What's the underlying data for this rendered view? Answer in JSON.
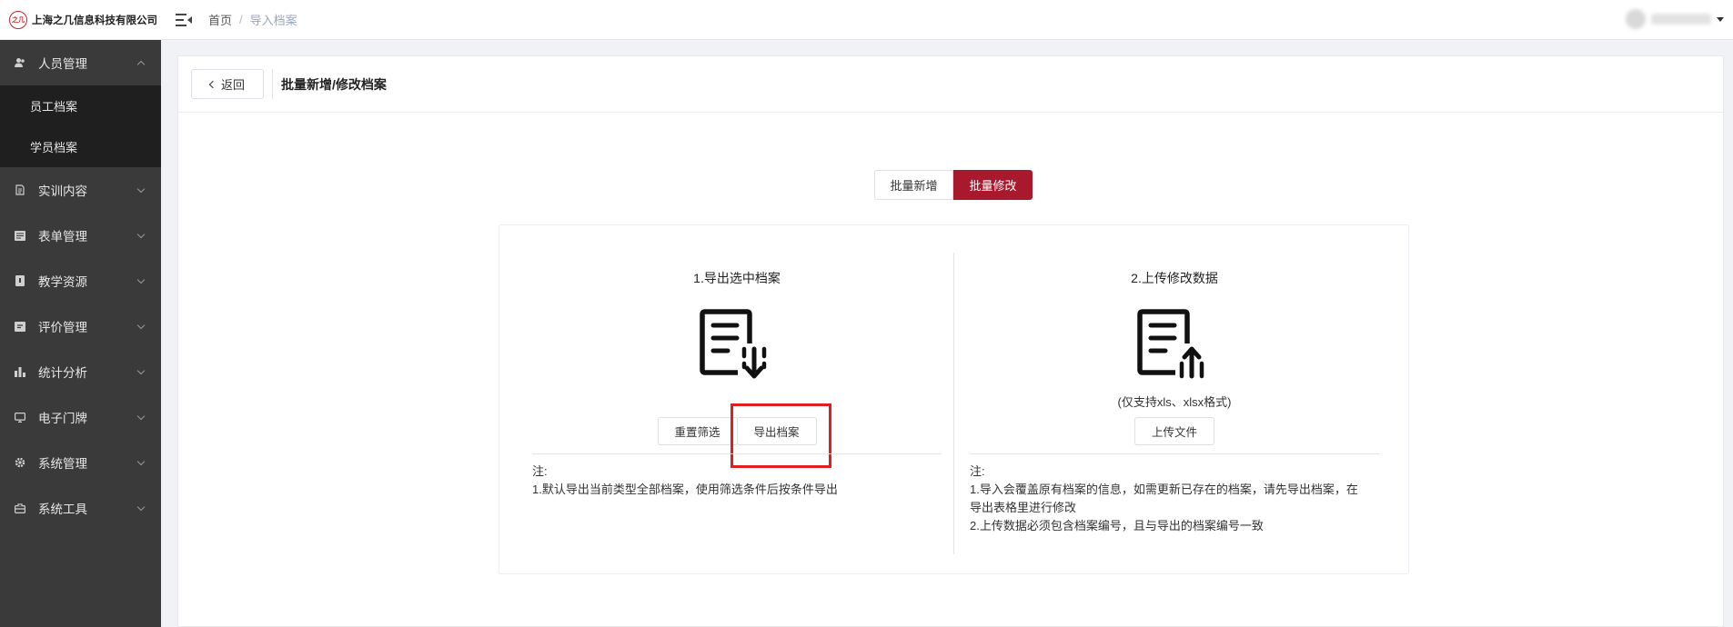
{
  "app": {
    "company_name": "上海之几信息科技有限公司",
    "logo_text": "之几"
  },
  "breadcrumb": {
    "home": "首页",
    "separator": "/",
    "current": "导入档案"
  },
  "sidebar": {
    "items": [
      {
        "label": "人员管理",
        "icon": "people-icon",
        "expanded": true,
        "children": [
          "员工档案",
          "学员档案"
        ]
      },
      {
        "label": "实训内容",
        "icon": "document-list-icon"
      },
      {
        "label": "表单管理",
        "icon": "form-icon"
      },
      {
        "label": "教学资源",
        "icon": "book-icon"
      },
      {
        "label": "评价管理",
        "icon": "evaluation-icon"
      },
      {
        "label": "统计分析",
        "icon": "bar-chart-icon"
      },
      {
        "label": "电子门牌",
        "icon": "monitor-icon"
      },
      {
        "label": "系统管理",
        "icon": "gear-icon"
      },
      {
        "label": "系统工具",
        "icon": "toolbox-icon"
      }
    ]
  },
  "header": {
    "back_label": "返回",
    "title": "批量新增/修改档案"
  },
  "mode_tabs": {
    "tab_add": "批量新增",
    "tab_edit": "批量修改",
    "active": "批量修改"
  },
  "export_step": {
    "title": "1.导出选中档案",
    "icon": "document-download-icon",
    "reset_label": "重置筛选",
    "export_label": "导出档案",
    "note_title": "注:",
    "note_lines": [
      "1.默认导出当前类型全部档案，使用筛选条件后按条件导出"
    ]
  },
  "upload_step": {
    "title": "2.上传修改数据",
    "icon": "document-upload-icon",
    "format_hint": "(仅支持xls、xlsx格式)",
    "upload_label": "上传文件",
    "note_title": "注:",
    "note_lines": [
      "1.导入会覆盖原有档案的信息，如需更新已存在的档案，请先导出档案，在",
      "导出表格里进行修改",
      "2.上传数据必须包含档案编号，且与导出的档案编号一致"
    ]
  },
  "colors": {
    "accent": "#a8192e",
    "sidebar_bg": "#3a3a3a",
    "submenu_bg": "#1f1f1f",
    "highlight": "#e02020"
  }
}
